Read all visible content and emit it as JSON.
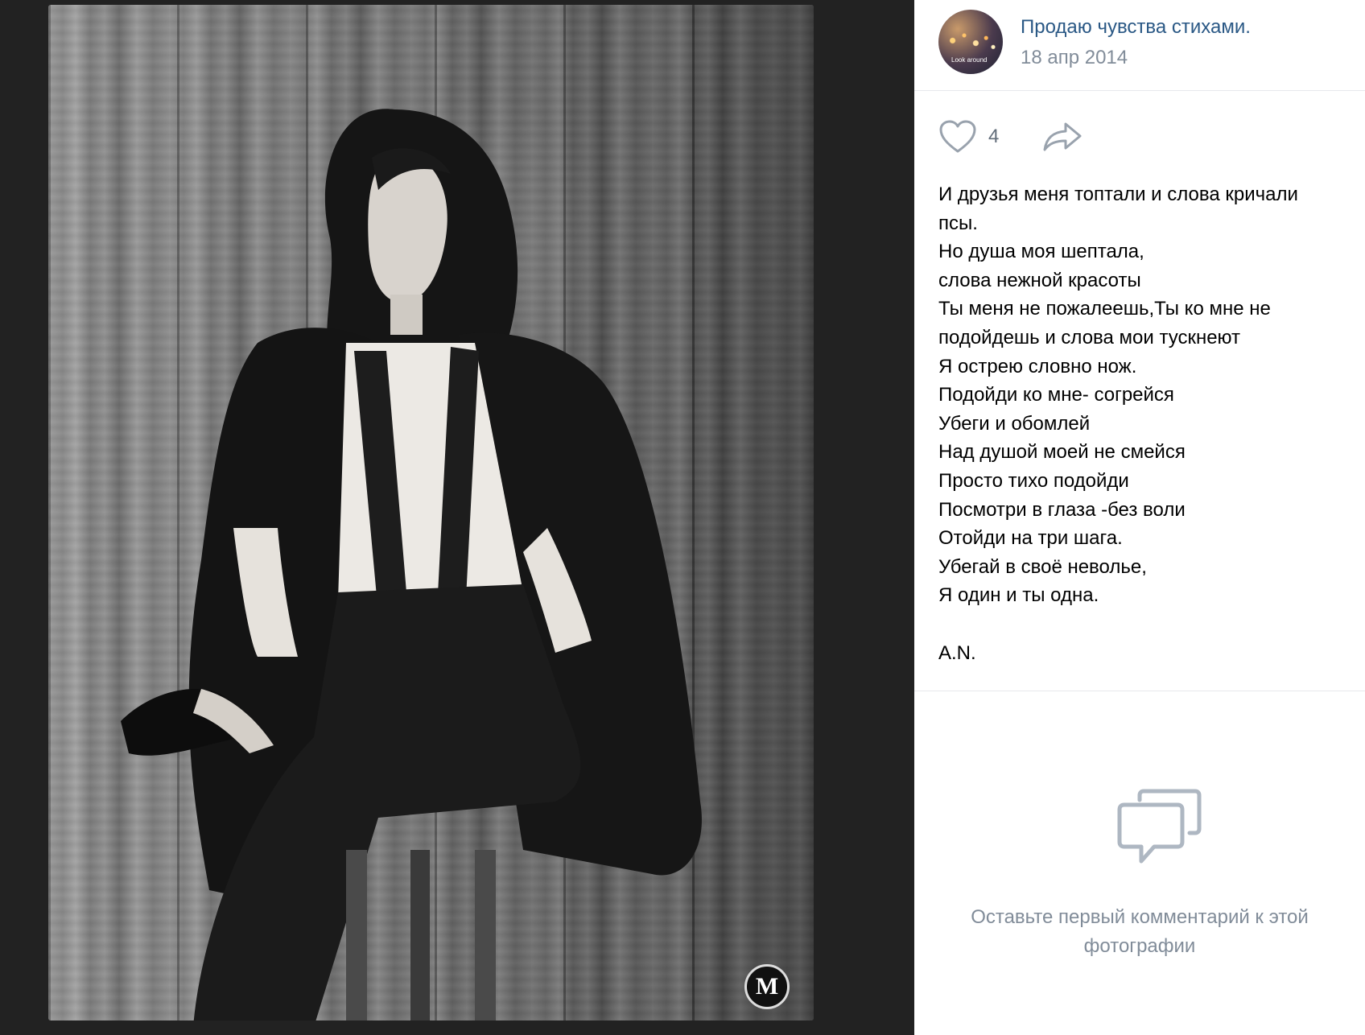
{
  "header": {
    "group_name": "Продаю чувства стихами.",
    "date": "18 апр 2014",
    "avatar_caption": "Look around"
  },
  "actions": {
    "like_count": "4",
    "like_icon": "heart-icon",
    "share_icon": "share-icon"
  },
  "post": {
    "lines": [
      "И друзья меня топтали и слова кричали",
      "псы.",
      "Но душа моя шептала,",
      "слова нежной красоты",
      "Ты меня не пожалеешь,Ты ко мне не",
      "подойдешь и слова мои тускнеют",
      "Я острею словно нож.",
      "Подойди ко мне- согрейся",
      "Убеги и обомлей",
      "Над душой моей не смейся",
      "Просто тихо подойди",
      "Посмотри в глаза -без воли",
      "Отойди на три шага.",
      "Убегай в своё неволье,",
      "Я один и ты одна."
    ],
    "signature": "A.N."
  },
  "comments": {
    "empty_line1": "Оставьте первый комментарий к этой",
    "empty_line2": "фотографии",
    "icon": "comment-icon"
  },
  "photo": {
    "watermark": "M"
  },
  "colors": {
    "link": "#2a5885",
    "muted": "#818c99",
    "icon": "#99a2ad"
  }
}
